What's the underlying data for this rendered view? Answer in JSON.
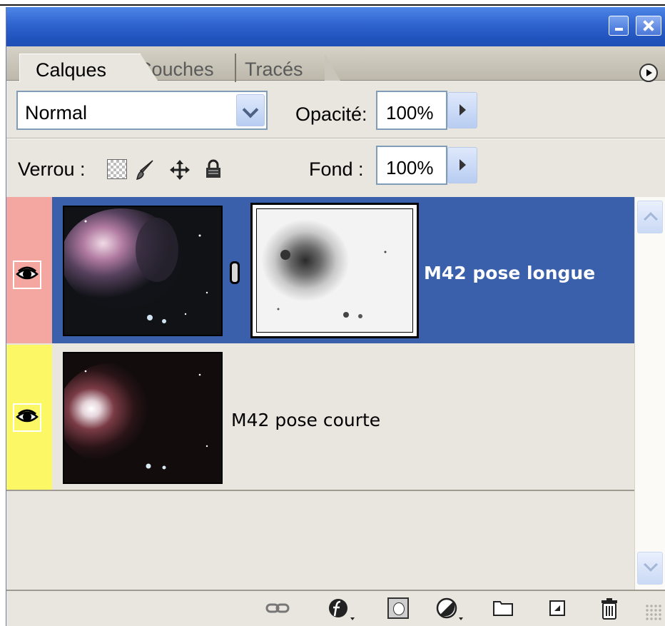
{
  "panel": {
    "tabs": [
      {
        "label": "Calques",
        "active": true
      },
      {
        "label": "Couches",
        "active": false
      },
      {
        "label": "Tracés",
        "active": false
      }
    ]
  },
  "controls": {
    "blend_mode": "Normal",
    "opacity_label": "Opacité:",
    "opacity_value": "100%",
    "lock_label": "Verrou :",
    "fill_label": "Fond :",
    "fill_value": "100%"
  },
  "layers": [
    {
      "name": "M42 pose longue",
      "selected": true,
      "visible": true,
      "label_color": "#f4a7a1",
      "has_mask": true
    },
    {
      "name": "M42 pose courte",
      "selected": false,
      "visible": true,
      "label_color": "#fcf765",
      "has_mask": false
    }
  ],
  "icons": {
    "titlebar": [
      "minimize-icon",
      "close-icon"
    ],
    "locks": [
      "lock-transparency-icon",
      "lock-paint-icon",
      "lock-position-icon",
      "lock-all-icon"
    ],
    "bottom": [
      "link-layers-icon",
      "layer-style-icon",
      "add-mask-icon",
      "adjustment-layer-icon",
      "new-group-icon",
      "new-layer-icon",
      "delete-layer-icon"
    ]
  },
  "colors": {
    "selection": "#3a5fab",
    "titlebar": "#2f63cf"
  }
}
